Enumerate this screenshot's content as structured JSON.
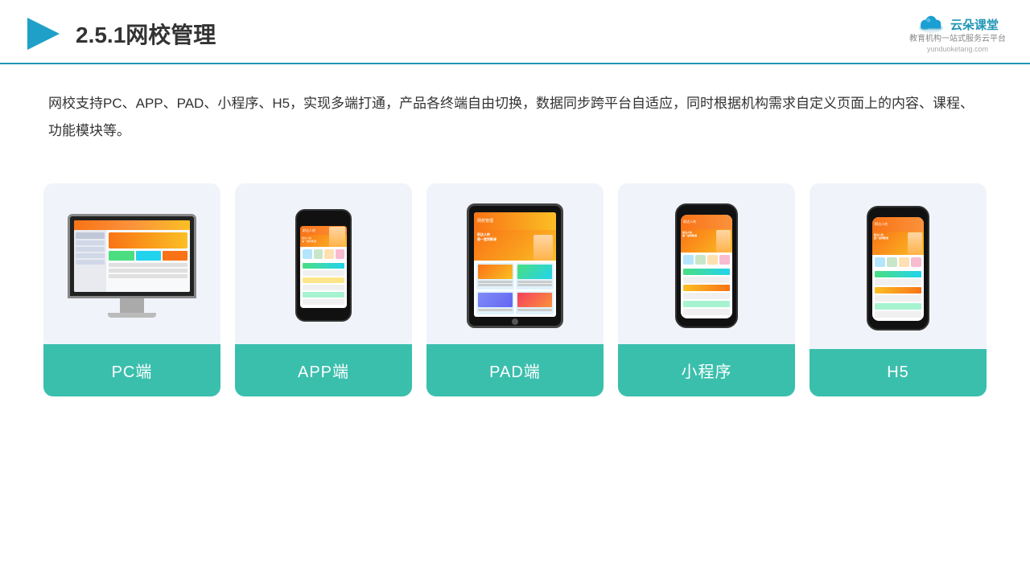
{
  "header": {
    "title": "2.5.1网校管理",
    "logo": {
      "name": "云朵课堂",
      "url": "yunduoketang.com",
      "tagline": "教育机构一站\n式服务云平台"
    }
  },
  "description": "网校支持PC、APP、PAD、小程序、H5，实现多端打通，产品各终端自由切换，数据同步跨平台自适应，同时根据机构需求自定义页面上的内容、课程、功能模块等。",
  "cards": [
    {
      "id": "pc",
      "label": "PC端"
    },
    {
      "id": "app",
      "label": "APP端"
    },
    {
      "id": "pad",
      "label": "PAD端"
    },
    {
      "id": "miniprogram",
      "label": "小程序"
    },
    {
      "id": "h5",
      "label": "H5"
    }
  ],
  "colors": {
    "accent": "#3bbfad",
    "headerBorder": "#2196b5",
    "titleColor": "#333333",
    "logoColor": "#2196b5"
  }
}
